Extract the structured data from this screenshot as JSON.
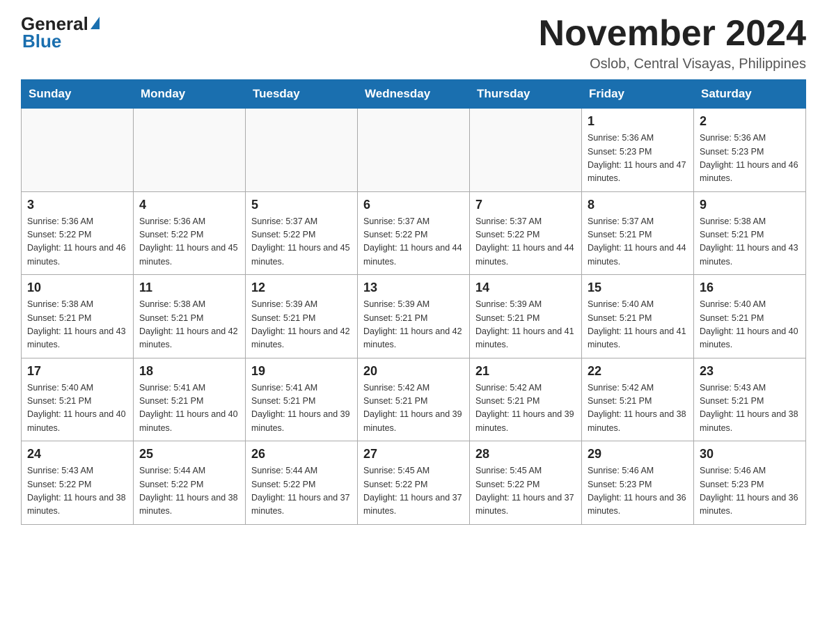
{
  "header": {
    "logo_line1": "General",
    "logo_line2": "Blue",
    "title": "November 2024",
    "subtitle": "Oslob, Central Visayas, Philippines"
  },
  "days_of_week": [
    "Sunday",
    "Monday",
    "Tuesday",
    "Wednesday",
    "Thursday",
    "Friday",
    "Saturday"
  ],
  "weeks": [
    [
      {
        "day": "",
        "info": ""
      },
      {
        "day": "",
        "info": ""
      },
      {
        "day": "",
        "info": ""
      },
      {
        "day": "",
        "info": ""
      },
      {
        "day": "",
        "info": ""
      },
      {
        "day": "1",
        "info": "Sunrise: 5:36 AM\nSunset: 5:23 PM\nDaylight: 11 hours and 47 minutes."
      },
      {
        "day": "2",
        "info": "Sunrise: 5:36 AM\nSunset: 5:23 PM\nDaylight: 11 hours and 46 minutes."
      }
    ],
    [
      {
        "day": "3",
        "info": "Sunrise: 5:36 AM\nSunset: 5:22 PM\nDaylight: 11 hours and 46 minutes."
      },
      {
        "day": "4",
        "info": "Sunrise: 5:36 AM\nSunset: 5:22 PM\nDaylight: 11 hours and 45 minutes."
      },
      {
        "day": "5",
        "info": "Sunrise: 5:37 AM\nSunset: 5:22 PM\nDaylight: 11 hours and 45 minutes."
      },
      {
        "day": "6",
        "info": "Sunrise: 5:37 AM\nSunset: 5:22 PM\nDaylight: 11 hours and 44 minutes."
      },
      {
        "day": "7",
        "info": "Sunrise: 5:37 AM\nSunset: 5:22 PM\nDaylight: 11 hours and 44 minutes."
      },
      {
        "day": "8",
        "info": "Sunrise: 5:37 AM\nSunset: 5:21 PM\nDaylight: 11 hours and 44 minutes."
      },
      {
        "day": "9",
        "info": "Sunrise: 5:38 AM\nSunset: 5:21 PM\nDaylight: 11 hours and 43 minutes."
      }
    ],
    [
      {
        "day": "10",
        "info": "Sunrise: 5:38 AM\nSunset: 5:21 PM\nDaylight: 11 hours and 43 minutes."
      },
      {
        "day": "11",
        "info": "Sunrise: 5:38 AM\nSunset: 5:21 PM\nDaylight: 11 hours and 42 minutes."
      },
      {
        "day": "12",
        "info": "Sunrise: 5:39 AM\nSunset: 5:21 PM\nDaylight: 11 hours and 42 minutes."
      },
      {
        "day": "13",
        "info": "Sunrise: 5:39 AM\nSunset: 5:21 PM\nDaylight: 11 hours and 42 minutes."
      },
      {
        "day": "14",
        "info": "Sunrise: 5:39 AM\nSunset: 5:21 PM\nDaylight: 11 hours and 41 minutes."
      },
      {
        "day": "15",
        "info": "Sunrise: 5:40 AM\nSunset: 5:21 PM\nDaylight: 11 hours and 41 minutes."
      },
      {
        "day": "16",
        "info": "Sunrise: 5:40 AM\nSunset: 5:21 PM\nDaylight: 11 hours and 40 minutes."
      }
    ],
    [
      {
        "day": "17",
        "info": "Sunrise: 5:40 AM\nSunset: 5:21 PM\nDaylight: 11 hours and 40 minutes."
      },
      {
        "day": "18",
        "info": "Sunrise: 5:41 AM\nSunset: 5:21 PM\nDaylight: 11 hours and 40 minutes."
      },
      {
        "day": "19",
        "info": "Sunrise: 5:41 AM\nSunset: 5:21 PM\nDaylight: 11 hours and 39 minutes."
      },
      {
        "day": "20",
        "info": "Sunrise: 5:42 AM\nSunset: 5:21 PM\nDaylight: 11 hours and 39 minutes."
      },
      {
        "day": "21",
        "info": "Sunrise: 5:42 AM\nSunset: 5:21 PM\nDaylight: 11 hours and 39 minutes."
      },
      {
        "day": "22",
        "info": "Sunrise: 5:42 AM\nSunset: 5:21 PM\nDaylight: 11 hours and 38 minutes."
      },
      {
        "day": "23",
        "info": "Sunrise: 5:43 AM\nSunset: 5:21 PM\nDaylight: 11 hours and 38 minutes."
      }
    ],
    [
      {
        "day": "24",
        "info": "Sunrise: 5:43 AM\nSunset: 5:22 PM\nDaylight: 11 hours and 38 minutes."
      },
      {
        "day": "25",
        "info": "Sunrise: 5:44 AM\nSunset: 5:22 PM\nDaylight: 11 hours and 38 minutes."
      },
      {
        "day": "26",
        "info": "Sunrise: 5:44 AM\nSunset: 5:22 PM\nDaylight: 11 hours and 37 minutes."
      },
      {
        "day": "27",
        "info": "Sunrise: 5:45 AM\nSunset: 5:22 PM\nDaylight: 11 hours and 37 minutes."
      },
      {
        "day": "28",
        "info": "Sunrise: 5:45 AM\nSunset: 5:22 PM\nDaylight: 11 hours and 37 minutes."
      },
      {
        "day": "29",
        "info": "Sunrise: 5:46 AM\nSunset: 5:23 PM\nDaylight: 11 hours and 36 minutes."
      },
      {
        "day": "30",
        "info": "Sunrise: 5:46 AM\nSunset: 5:23 PM\nDaylight: 11 hours and 36 minutes."
      }
    ]
  ]
}
